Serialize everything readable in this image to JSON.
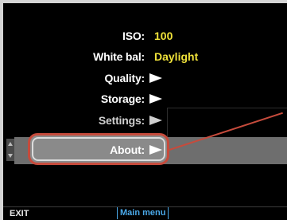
{
  "menu": {
    "items": [
      {
        "label": "ISO:",
        "value": "100"
      },
      {
        "label": "White bal:",
        "value": "Daylight"
      },
      {
        "label": "Quality:",
        "value": ""
      },
      {
        "label": "Storage:",
        "value": ""
      },
      {
        "label": "Settings:",
        "value": ""
      },
      {
        "label": "About:",
        "value": ""
      }
    ],
    "selected_index": 5
  },
  "footer": {
    "exit_label": "EXIT",
    "main_menu_label": "Main menu"
  },
  "colors": {
    "value_text": "#f0e23a",
    "highlight_border": "#c64b3c",
    "footer_active": "#4aa8e8"
  }
}
